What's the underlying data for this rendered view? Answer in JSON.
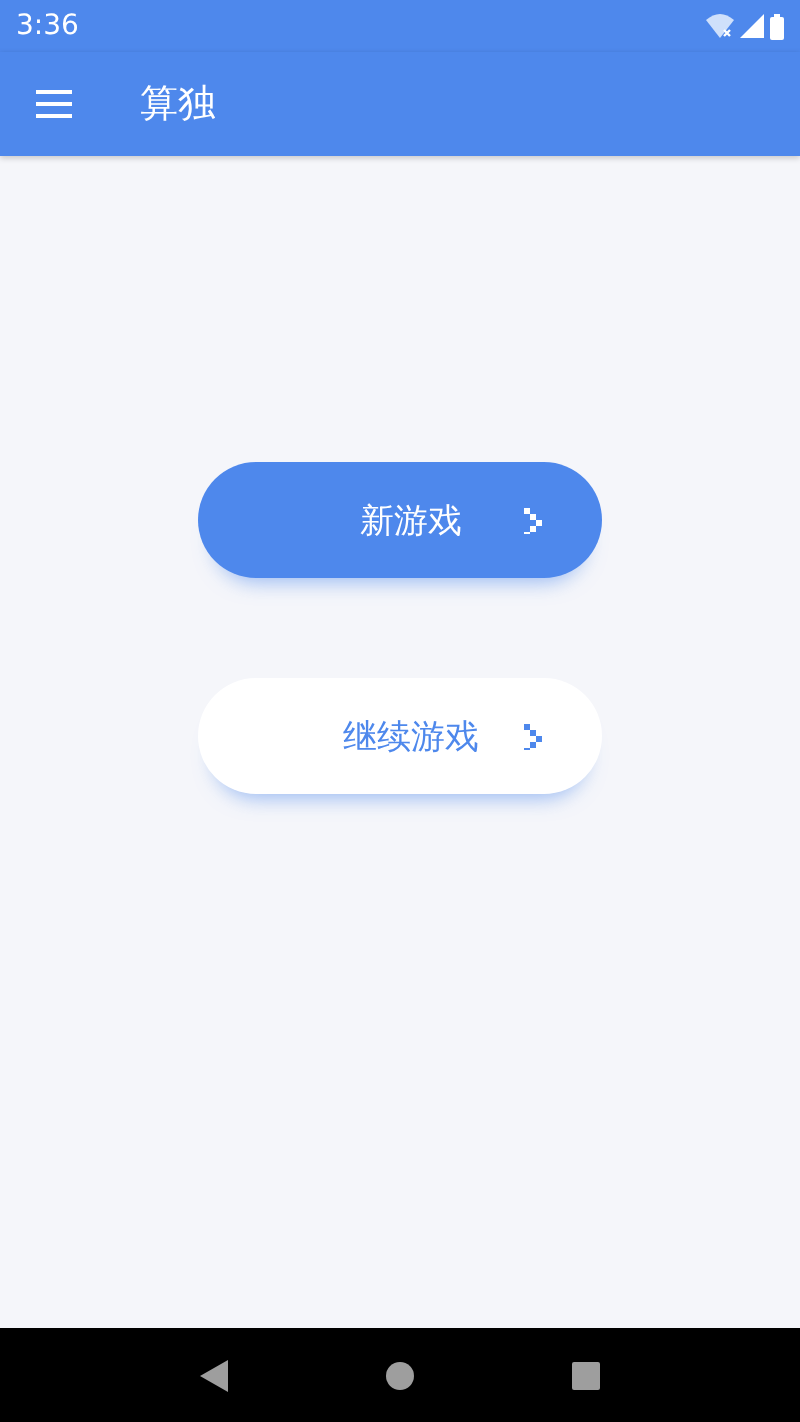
{
  "status_bar": {
    "time": "3:36"
  },
  "app_bar": {
    "title": "算独"
  },
  "buttons": [
    {
      "label": "新游戏",
      "kind": "primary"
    },
    {
      "label": "继续游戏",
      "kind": "secondary"
    }
  ]
}
